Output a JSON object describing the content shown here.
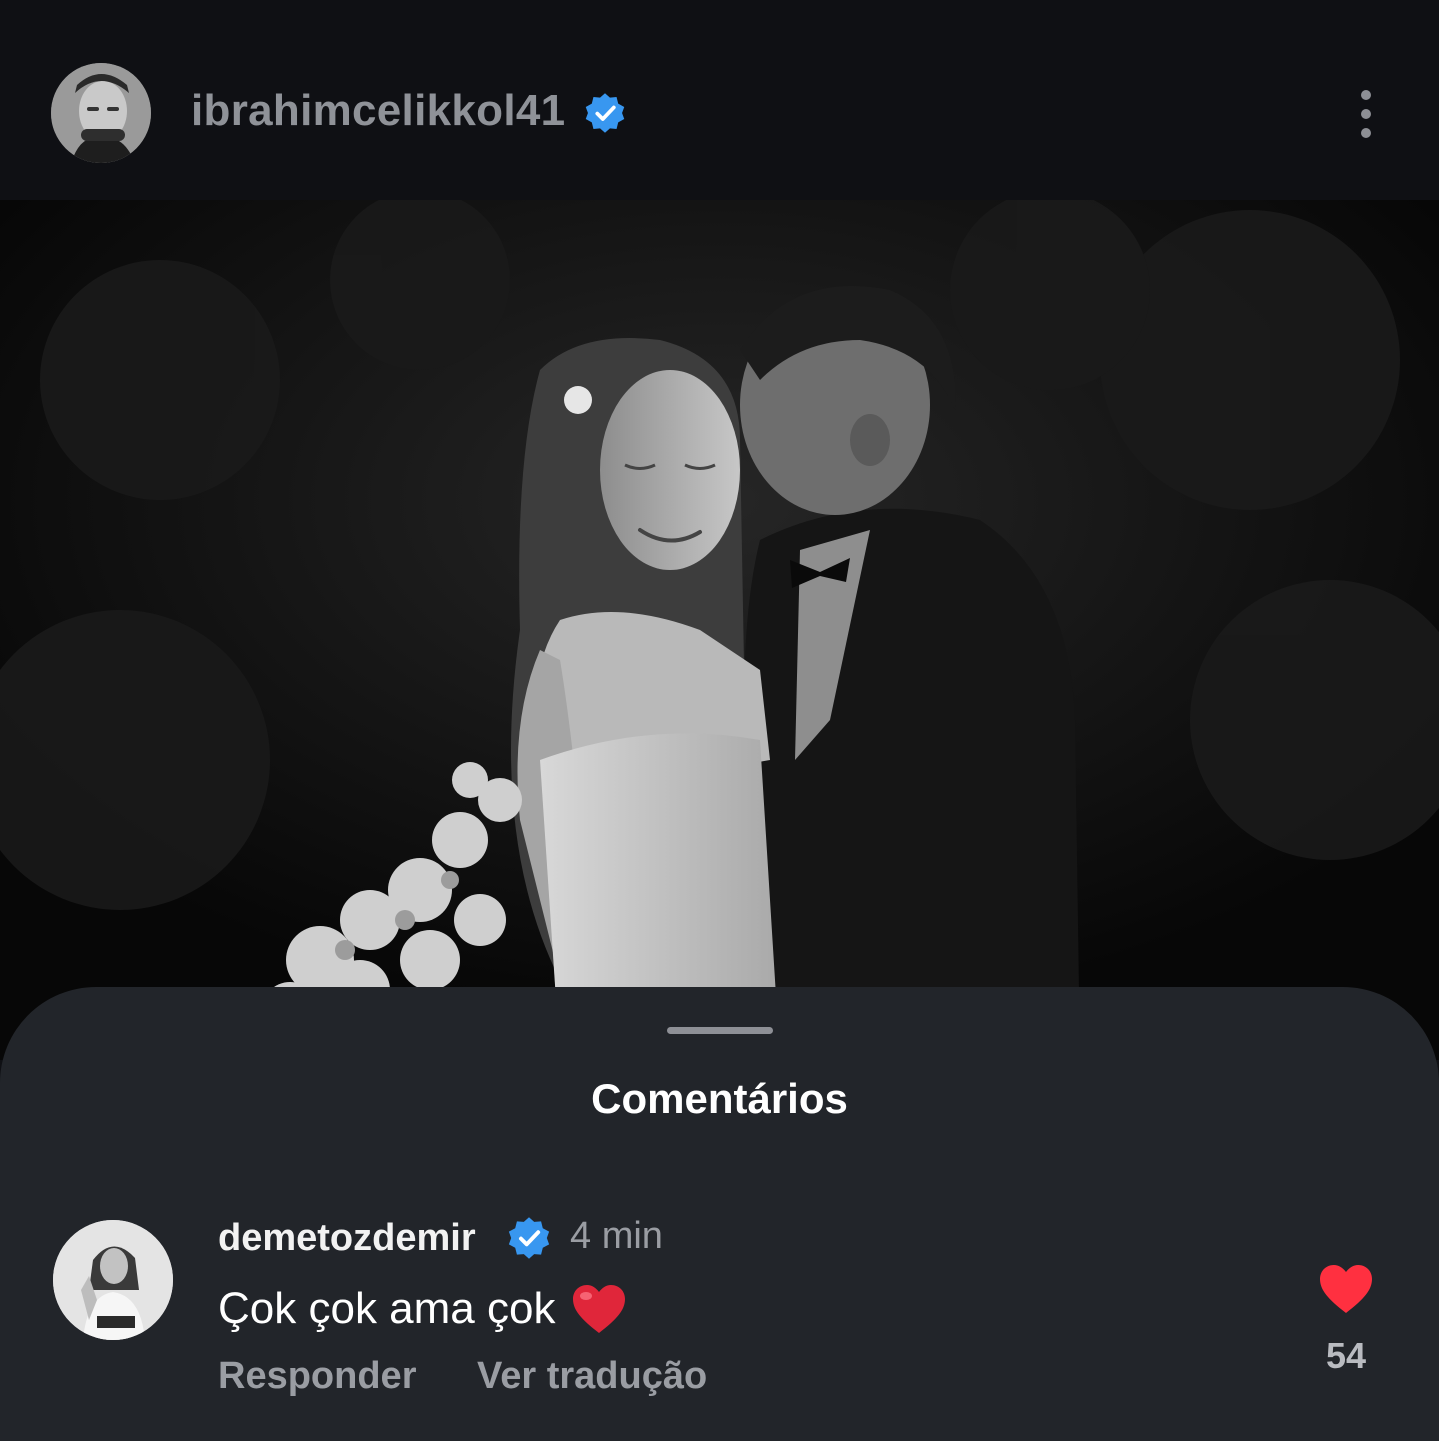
{
  "post": {
    "username": "ibrahimcelikkol41",
    "verified": true,
    "verified_color": "#3897f0",
    "image_alt": "Black and white wedding photo: groom kissing bride's temple, bride holding white bouquet"
  },
  "comments_sheet": {
    "title": "Comentários",
    "comments": [
      {
        "username": "demetozdemir",
        "verified": true,
        "time": "4 min",
        "text": "Çok çok ama çok",
        "emoji": "red-heart",
        "reply_label": "Responder",
        "translate_label": "Ver tradução",
        "likes": "54",
        "liked": true,
        "like_color": "#ff3040"
      }
    ]
  },
  "icons": {
    "verified": "verified-badge-icon",
    "more": "more-vertical-icon",
    "like": "heart-icon"
  }
}
